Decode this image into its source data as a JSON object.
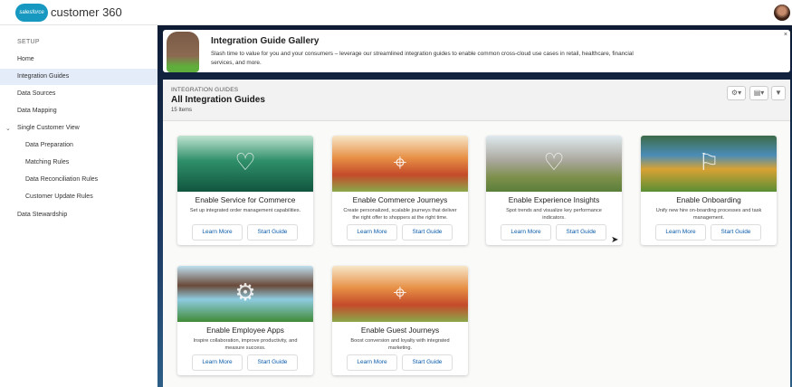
{
  "header": {
    "logo_text": "salesforce",
    "app_name": "customer 360"
  },
  "sidebar": {
    "section": "SETUP",
    "items": [
      {
        "label": "Home"
      },
      {
        "label": "Integration Guides",
        "selected": true
      },
      {
        "label": "Data Sources"
      },
      {
        "label": "Data Mapping"
      },
      {
        "label": "Single Customer View",
        "expanded": true
      },
      {
        "label": "Data Preparation"
      },
      {
        "label": "Matching Rules"
      },
      {
        "label": "Data Reconciliation Rules"
      },
      {
        "label": "Customer Update Rules"
      },
      {
        "label": "Data Stewardship"
      }
    ]
  },
  "banner": {
    "title": "Integration Guide Gallery",
    "description": "Slash time to value for you and your consumers – leverage our streamlined integration guides to enable common cross-cloud use cases in retail, healthcare, financial services, and more.",
    "close": "×"
  },
  "list": {
    "object_label": "INTEGRATION GUIDES",
    "title": "All Integration Guides",
    "count": "15 Items",
    "toolbar": {
      "settings": "⚙▾",
      "view": "▤▾",
      "filter": "▼"
    }
  },
  "cards": [
    {
      "title": "Enable Service for Commerce",
      "description": "Set up integrated order management capabilities.",
      "icon": "heart-icon",
      "learn": "Learn More",
      "start": "Start Guide"
    },
    {
      "title": "Enable Commerce Journeys",
      "description": "Create personalized, scalable journeys that deliver the right offer to shoppers at the right time.",
      "icon": "map-pin-icon",
      "learn": "Learn More",
      "start": "Start Guide"
    },
    {
      "title": "Enable Experience Insights",
      "description": "Spot trends and visualize key performance indicators.",
      "icon": "heart-icon",
      "learn": "Learn More",
      "start": "Start Guide"
    },
    {
      "title": "Enable Onboarding",
      "description": "Unify new hire on-boarding processes and task management.",
      "icon": "flag-icon",
      "learn": "Learn More",
      "start": "Start Guide"
    },
    {
      "title": "Enable Employee Apps",
      "description": "Inspire collaboration, improve productivity, and measure success.",
      "icon": "gear-icon",
      "learn": "Learn More",
      "start": "Start Guide"
    },
    {
      "title": "Enable Guest Journeys",
      "description": "Boost conversion and loyalty with integrated marketing.",
      "icon": "map-pin-icon",
      "learn": "Learn More",
      "start": "Start Guide"
    }
  ]
}
